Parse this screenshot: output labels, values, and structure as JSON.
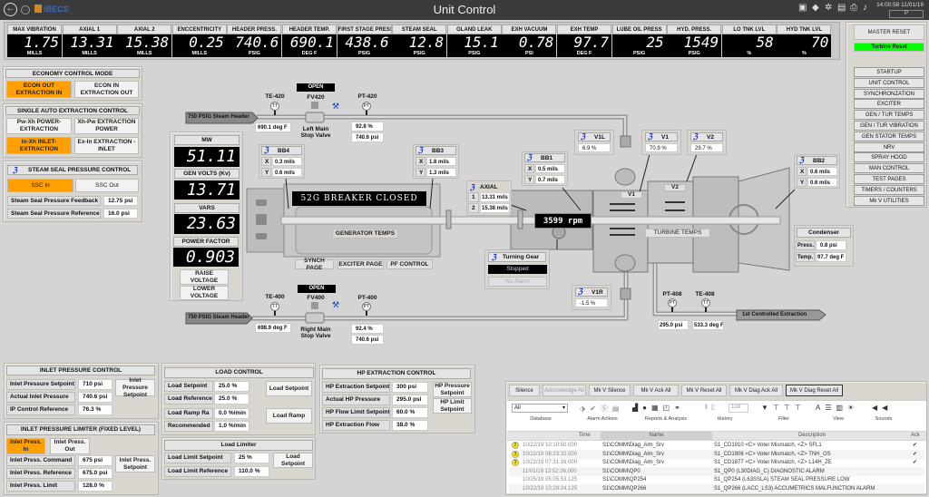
{
  "header": {
    "title": "Unit Control",
    "logo": "IBECS",
    "time": "14:00:58 11/01/19",
    "user": "P",
    "icons": [
      "back-arrow-icon",
      "forward-arrow-icon",
      "screenshot-icon",
      "tag-icon",
      "settings-icon",
      "report-icon",
      "print-icon",
      "bell-icon"
    ]
  },
  "gauges": [
    {
      "label": "MAX VIBRATION",
      "value": "1.75",
      "unit": "MILLS"
    },
    {
      "label": "AXIAL 1",
      "value": "13.31",
      "unit": "MILLS"
    },
    {
      "label": "AXIAL 2",
      "value": "15.38",
      "unit": "MILLS"
    },
    {
      "label": "ENCCENTRICITY",
      "value": "0.25",
      "unit": "MILLS"
    },
    {
      "label": "HEADER PRESS.",
      "value": "740.6",
      "unit": "PSIG"
    },
    {
      "label": "HEADER TEMP.",
      "value": "690.1",
      "unit": "DEG F"
    },
    {
      "label": "FIRST STAGE PRESS",
      "value": "438.6",
      "unit": "PSIG"
    },
    {
      "label": "STEAM SEAL",
      "value": "12.8",
      "unit": "PSIG"
    },
    {
      "label": "GLAND LEAK",
      "value": "15.1",
      "unit": "PSIG"
    },
    {
      "label": "EXH VACUUM",
      "value": "0.78",
      "unit": "PSI"
    },
    {
      "label": "EXH TEMP",
      "value": "97.7",
      "unit": "DEG F"
    },
    {
      "label": "LUBE OIL PRESS",
      "value": "25",
      "unit": "PSIG"
    },
    {
      "label": "HYD. PRESS.",
      "value": "1549",
      "unit": "PSIG"
    },
    {
      "label": "LO TNK LVL",
      "value": "58",
      "unit": "%"
    },
    {
      "label": "HYD TNK LVL",
      "value": "70",
      "unit": "%"
    }
  ],
  "right": {
    "master_reset": "MASTER RESET",
    "turbine_reset": "Turbine Reset",
    "turbine_reset_color": "#00ff00",
    "nav": [
      "STARTUP",
      "UNIT CONTROL",
      "SYNCHRONZATION",
      "EXCITER",
      "GEN / TUR TEMPS",
      "GEN / TUR VIBRATION",
      "GEN STATOR TEMPS",
      "NRV",
      "SPRAY HOOD",
      "MAN CONTROL",
      "TEST PAGES",
      "TIMERS / COUNTERS",
      "Mk V UTILITIES"
    ]
  },
  "economy": {
    "title": "ECONOMY CONTROL MODE",
    "btn1": "ECON OUT EXTRACTION IN",
    "btn2": "ECON IN EXTRACTION OUT",
    "active": "btn1"
  },
  "single_auto": {
    "title": "SINGLE AUTO EXTRACTION CONTROL",
    "b1": "Pw-Xh POWER-EXTRACTION",
    "b2": "Xh-Pw EXTRACTION POWER",
    "b3": "In-Xh INLET-EXTRACTION",
    "b4": "Ex-In EXTRACTION - INLET",
    "active": "b3"
  },
  "steam_seal": {
    "title": "STEAM SEAL PRESSURE CONTROL",
    "ssc_in": "SSC In",
    "ssc_out": "SSC Out",
    "feedback_label": "Steam Seal Pressure Feedback",
    "feedback": "12.75 psi",
    "reference_label": "Steam Seal Pressure Reference",
    "reference": "16.0 psi"
  },
  "accent": "#ff9f00",
  "gen_panel": {
    "mw_label": "MW",
    "mw": "51.11",
    "volts_label": "GEN VOLTS (Kv)",
    "volts": "13.71",
    "vars_label": "VARS",
    "vars": "23.63",
    "pf_label": "POWER FACTOR",
    "pf": "0.903",
    "raise": "RAISE VOLTAGE",
    "lower": "LOWER VOLTAGE"
  },
  "top_header": {
    "label": "750 PSIG Steam Header",
    "te": "TE-420",
    "te_val": "690.1 deg F",
    "fv": "FV420",
    "valve_state": "OPEN",
    "valve_name": "Left Main Stop Valve",
    "pt": "PT-420",
    "pt_pct": "92.8 %",
    "pt_psi": "740.6 psi",
    "tt": "TT",
    "ptsym": "PT"
  },
  "bot_header": {
    "label": "750 PSIG Steam Header",
    "te": "TE-400",
    "te_val": "698.9 deg F",
    "fv": "FV400",
    "valve_state": "OPEN",
    "valve_name": "Right Main Stop Valve",
    "pt": "PT-400",
    "pt_pct": "92.4 %",
    "pt_psi": "740.6 psi"
  },
  "bearings": {
    "bb4": {
      "name": "BB4",
      "x": "0.3 mils",
      "y": "0.6 mils"
    },
    "bb3": {
      "name": "BB3",
      "x": "1.8 mils",
      "y": "1.3 mils"
    },
    "bb1": {
      "name": "BB1",
      "x": "0.5 mils",
      "y": "0.7 mils"
    },
    "bb2": {
      "name": "BB2",
      "x": "0.6 mils",
      "y": "0.6 mils"
    },
    "xl": "X",
    "yl": "Y"
  },
  "axial": {
    "name": "AXIAL",
    "l1": "1",
    "v1": "13.31 mils",
    "l2": "2",
    "v2": "15.38 mils"
  },
  "generator": {
    "breaker": "52G BREAKER CLOSED",
    "temps": "GENERATOR TEMPS",
    "synch": "SYNCH PAGE",
    "exciter": "EXCITER PAGE",
    "pf": "PF CONTROL"
  },
  "turbine": {
    "rpm": "3599 rpm",
    "temps": "TURBINE TEMPS",
    "v1_tag": "V1",
    "v2_tag": "V2"
  },
  "valves": {
    "v1l": {
      "name": "V1L",
      "val": "6.9 %"
    },
    "v1": {
      "name": "V1",
      "val": "70.9 %"
    },
    "v2": {
      "name": "V2",
      "val": "29.7 %"
    },
    "v1r": {
      "name": "V1R",
      "val": "-1.5 %"
    }
  },
  "turning_gear": {
    "name": "Turning Gear",
    "status": "Stopped",
    "alarm": "No Alarm"
  },
  "condenser": {
    "name": "Condenser",
    "press_l": "Press.",
    "press": "0.8 psi",
    "temp_l": "Temp.",
    "temp": "97.7 deg F"
  },
  "extraction": {
    "label": "1st Controlled Extraction",
    "pt": "PT-408",
    "te": "TE-408",
    "pt_val": "295.0 psi",
    "te_val": "533.3 deg F"
  },
  "inlet": {
    "title": "INLET PRESSURE CONTROL",
    "sp_l": "Inlet Pressure Setpoint",
    "sp": "710 psi",
    "act_l": "Actual Inlet Pressure",
    "act": "740.6 psi",
    "ipc_l": "IP Control Reference",
    "ipc": "76.3 %",
    "btn": "Inlet Pressure Setpoint"
  },
  "limiter": {
    "title": "INLET PRESSURE LIMITER (FIXED LEVEL)",
    "in": "Inlet Press. In",
    "out": "Inlet Press. Out",
    "cmd_l": "Inlet Press. Command",
    "cmd": "675 psi",
    "ref_l": "Inlet Press. Reference",
    "ref": "675.0 psi",
    "lim_l": "Inlet Press. Limit",
    "lim": "128.0 %",
    "btn": "Inlet Press. Setpoint"
  },
  "load": {
    "title": "LOAD CONTROL",
    "sp_l": "Load Setpoint",
    "sp": "25.0 %",
    "ref_l": "Load Reference",
    "ref": "25.0 %",
    "ramp_l": "Load Ramp Ra",
    "ramp": "0.0 %/min",
    "rec_l": "Recommended",
    "rec": "1.0 %/min",
    "btn_sp": "Load Setpoint",
    "btn_ramp": "Load Ramp"
  },
  "load_limiter": {
    "title": "Load Limiter",
    "sp_l": "Load Limit Setpoint",
    "sp": "25 %",
    "ref_l": "Load Limit Reference",
    "ref": "110.0 %",
    "btn": "Load Setpoint"
  },
  "hp": {
    "title": "HP EXTRACTION CONTROL",
    "sp_l": "HP Extraction Setpoint",
    "sp": "300 psi",
    "act_l": "Actual HP Pressure",
    "act": "295.0 psi",
    "fl_l": "HP Flow Limit Setpoint",
    "fl": "60.0 %",
    "fw_l": "HP Extraction Flow",
    "fw": "38.0 %",
    "btn1": "HP Pressure Setpoint",
    "btn2": "HP Limit Setpoint"
  },
  "alarms": {
    "buttons": [
      "Silence",
      "Acknowledge All",
      "Mk V Silence",
      "Mk V Ack All",
      "Mk V Reset All",
      "Mk V Diag Ack All",
      "Mk V Diag Reset All"
    ],
    "database": "All",
    "history_range": "10d",
    "groups": [
      "Database",
      "Alarm Actions",
      "Reports & Analysis",
      "History",
      "Filter",
      "View",
      "Sounds"
    ],
    "columns": [
      "Time",
      "Name",
      "Description",
      "Ack"
    ],
    "rows": [
      {
        "badge": "2",
        "time": "10/22/19 10:10:50.000",
        "name": "S1\\COMM\\Diag_Alm_Srv",
        "desc": "S1_CD1910 <C> Voter Mismatch, <Z> SFL1",
        "ack": "✔"
      },
      {
        "badge": "3",
        "time": "10/22/19 08:23:32.000",
        "name": "S1\\COMM\\Diag_Alm_Srv",
        "desc": "S1_CD1906 <C> Voter Mismatch, <Z> TNH_OS",
        "ack": "✔"
      },
      {
        "badge": "3",
        "time": "10/22/19 07:31:16.000",
        "name": "S1\\COMM\\Diag_Alm_Srv",
        "desc": "S1_CD1877 <C> Voter Mismatch, <Z> L14H_ZE",
        "ack": "✔"
      },
      {
        "badge": "",
        "time": "11/01/19 13:52:36.000",
        "name": "S1\\COMM\\QP0",
        "desc": "S1_QP0 (L30DIAG_C) DIAGNOSTIC ALARM",
        "ack": ""
      },
      {
        "badge": "",
        "time": "10/25/19 05:05:53.125",
        "name": "S1\\COMM\\QP254",
        "desc": "S1_QP254 (L63SSLA) STEAM SEAL PRESSURE LOW",
        "ack": ""
      },
      {
        "badge": "",
        "time": "10/22/19 10:29:24.125",
        "name": "S1\\COMM\\QP266",
        "desc": "S1_QP266 (LACC_LS3) ACCUMETRICS MALFUNCTION ALARM",
        "ack": ""
      }
    ]
  }
}
